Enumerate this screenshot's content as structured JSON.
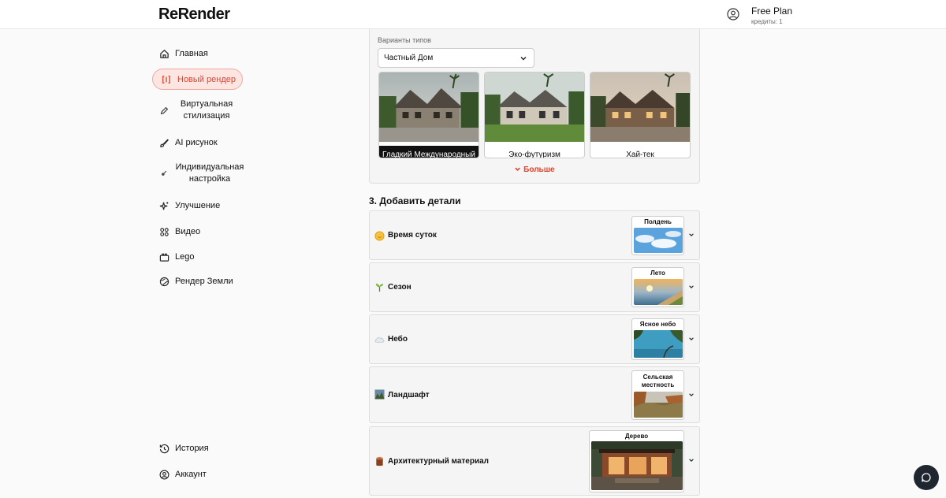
{
  "header": {
    "logo": "ReRender",
    "plan": "Free Plan",
    "credits": "кредиты: 1"
  },
  "sidebar": {
    "items": [
      {
        "label": "Главная",
        "icon": "home-icon"
      },
      {
        "label": "Новый рендер",
        "icon": "render-frame-icon",
        "active": true
      },
      {
        "label": "Виртуальная стилизация",
        "icon": "edit-icon"
      },
      {
        "label": "AI рисунок",
        "icon": "brush-icon"
      },
      {
        "label": "Индивидуальная настройка",
        "icon": "custom-icon"
      },
      {
        "label": "Улучшение",
        "icon": "sparkle-icon"
      },
      {
        "label": "Видео",
        "icon": "video-icon"
      },
      {
        "label": "Lego",
        "icon": "lego-icon"
      },
      {
        "label": "Рендер Земли",
        "icon": "globe-icon"
      }
    ],
    "bottom": [
      {
        "label": "История",
        "icon": "history-icon"
      },
      {
        "label": "Аккаунт",
        "icon": "account-icon"
      }
    ]
  },
  "types": {
    "label": "Варианты типов",
    "selected": "Частный Дом",
    "styles": [
      {
        "label": "Гладкий Международный",
        "selected": true
      },
      {
        "label": "Эко-футуризм"
      },
      {
        "label": "Хай-тек"
      }
    ],
    "more": "Больше"
  },
  "details": {
    "title": "3. Добавить детали",
    "rows": [
      {
        "label": "Время суток",
        "value": "Полдень",
        "icon": "sun-icon"
      },
      {
        "label": "Сезон",
        "value": "Лето",
        "icon": "sprout-icon"
      },
      {
        "label": "Небо",
        "value": "Ясное небо",
        "icon": "cloud-icon"
      },
      {
        "label": "Ландшафт",
        "value": "Сельская местность",
        "icon": "landscape-icon"
      },
      {
        "label": "Архитектурный материал",
        "value": "Дерево",
        "icon": "wood-icon"
      }
    ]
  },
  "colors": {
    "accent": "#e0432f",
    "accent_bg": "#fde5e1",
    "chat": "#1f2630"
  }
}
